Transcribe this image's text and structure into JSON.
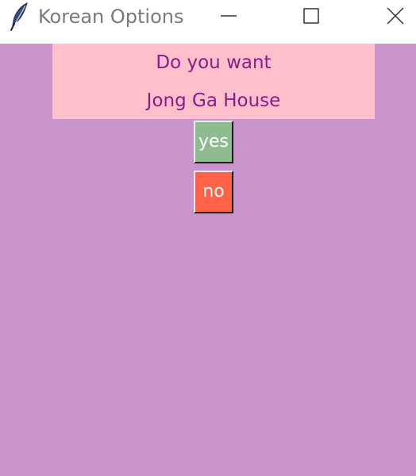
{
  "window": {
    "title": "Korean Options",
    "app_icon": "feather-icon"
  },
  "banner": {
    "line1": "Do you want",
    "line2": "Jong Ga House"
  },
  "buttons": {
    "yes_label": "yes",
    "no_label": "no"
  },
  "colors": {
    "background": "#c994cb",
    "banner_bg": "#ffc0cb",
    "banner_text": "#8b1a8b",
    "yes_bg": "#8fbc8f",
    "no_bg": "#ff6347"
  }
}
